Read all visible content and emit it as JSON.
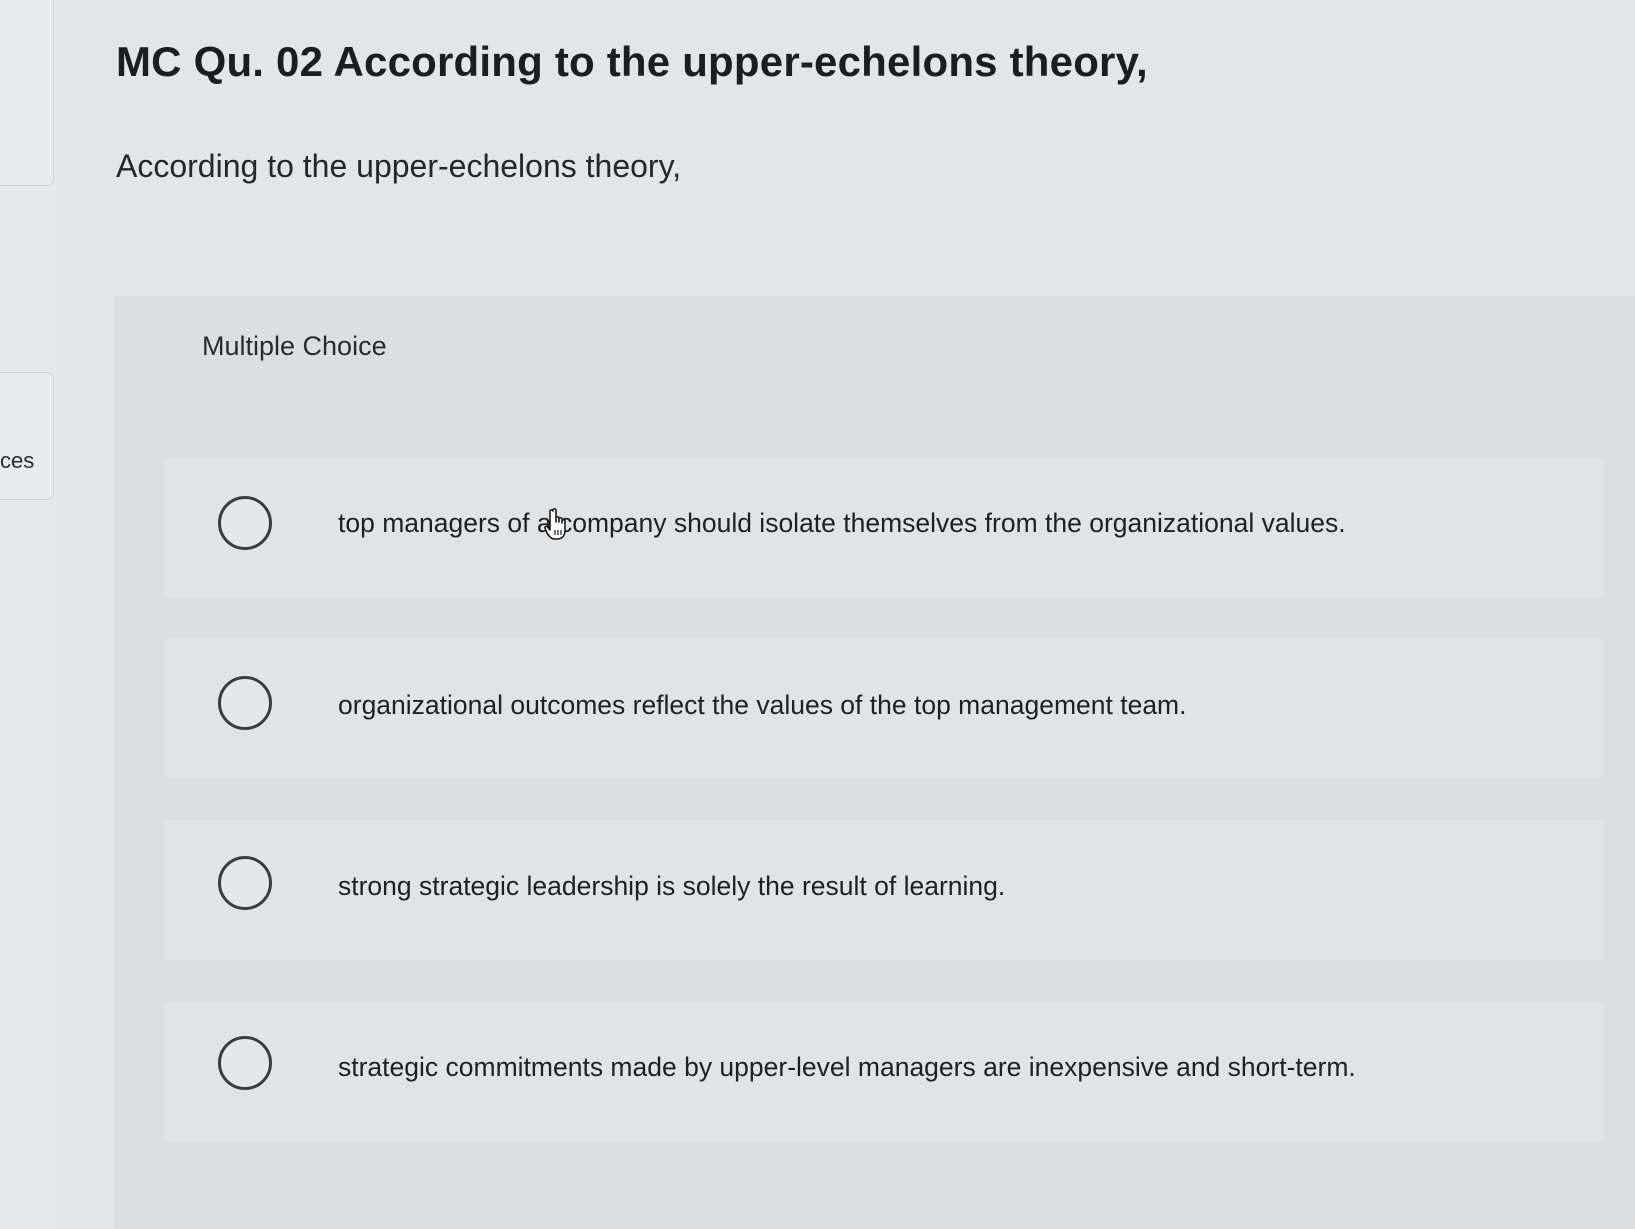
{
  "sidebar": {
    "partial_label": "ces"
  },
  "question": {
    "title": "MC Qu. 02 According to the upper-echelons theory,",
    "prompt": "According to the upper-echelons theory,"
  },
  "choices": {
    "heading": "Multiple Choice",
    "options": [
      {
        "label": "top managers of a company should isolate themselves from the organizational values."
      },
      {
        "label": "organizational outcomes reflect the values of the top management team."
      },
      {
        "label": "strong strategic leadership is solely the result of learning."
      },
      {
        "label": "strategic commitments made by upper-level managers are inexpensive and short-term."
      }
    ],
    "selected": null
  },
  "icons": {
    "cursor": "hand-pointer-icon",
    "radio": "radio-unselected-icon"
  },
  "colors": {
    "background": "#e4e5e7",
    "panel": "#dcdee0",
    "text": "#1f2023"
  }
}
